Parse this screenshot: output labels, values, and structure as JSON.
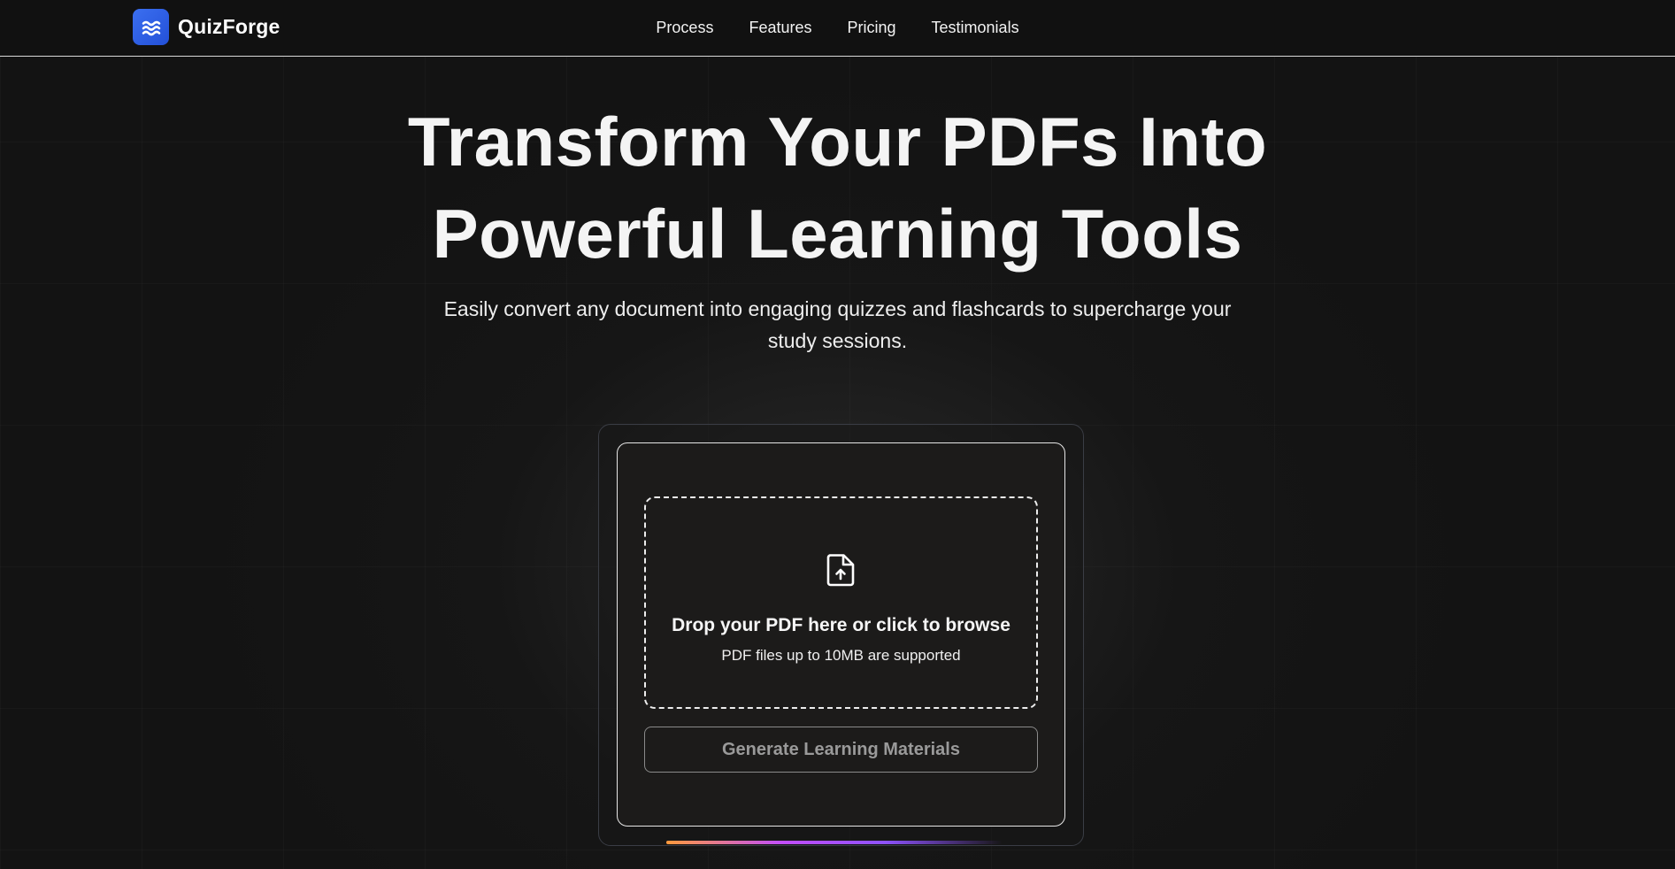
{
  "brand": {
    "name": "QuizForge",
    "logo_icon": "waves-icon",
    "accent_color": "#2f5fe6"
  },
  "nav": {
    "items": [
      {
        "label": "Process"
      },
      {
        "label": "Features"
      },
      {
        "label": "Pricing"
      },
      {
        "label": "Testimonials"
      }
    ]
  },
  "hero": {
    "title_line1": "Transform Your PDFs Into",
    "title_line2": "Powerful Learning Tools",
    "subtitle_line1": "Easily convert any document into engaging quizzes and flashcards to supercharge your",
    "subtitle_line2": "study sessions."
  },
  "upload": {
    "icon": "file-upload-icon",
    "drop_title": "Drop your PDF here or click to browse",
    "drop_hint": "PDF files up to 10MB are supported",
    "generate_label": "Generate Learning Materials"
  }
}
